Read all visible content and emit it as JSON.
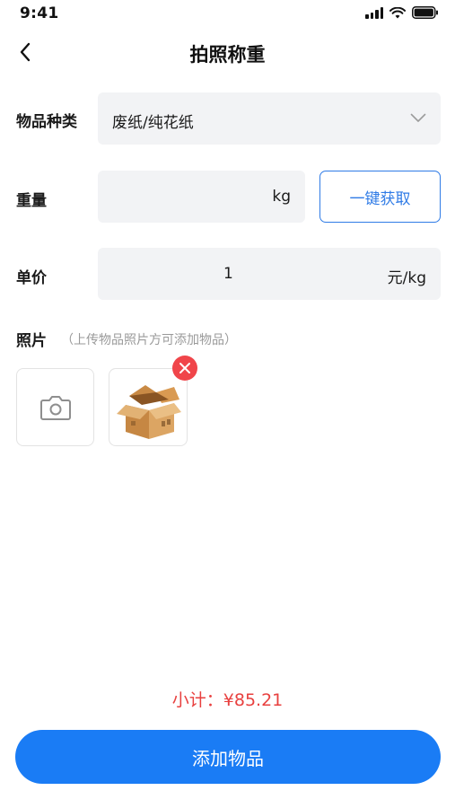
{
  "status_bar": {
    "time": "9:41"
  },
  "header": {
    "title": "拍照称重"
  },
  "form": {
    "category": {
      "label": "物品种类",
      "value": "废纸/纯花纸"
    },
    "weight": {
      "label": "重量",
      "value": "",
      "unit": "kg",
      "fetch_button": "一键获取"
    },
    "price": {
      "label": "单价",
      "value": "1",
      "unit": "元/kg"
    },
    "photo": {
      "label": "照片",
      "hint": "（上传物品照片方可添加物品）"
    }
  },
  "footer": {
    "subtotal_label": "小计：",
    "subtotal_value": "¥85.21",
    "add_button": "添加物品"
  },
  "colors": {
    "accent": "#1a7cf5",
    "danger": "#f0454a",
    "field_bg": "#f2f3f5"
  },
  "icons": [
    "back-arrow-icon",
    "chevron-down-icon",
    "camera-icon",
    "close-icon",
    "box-icon"
  ]
}
